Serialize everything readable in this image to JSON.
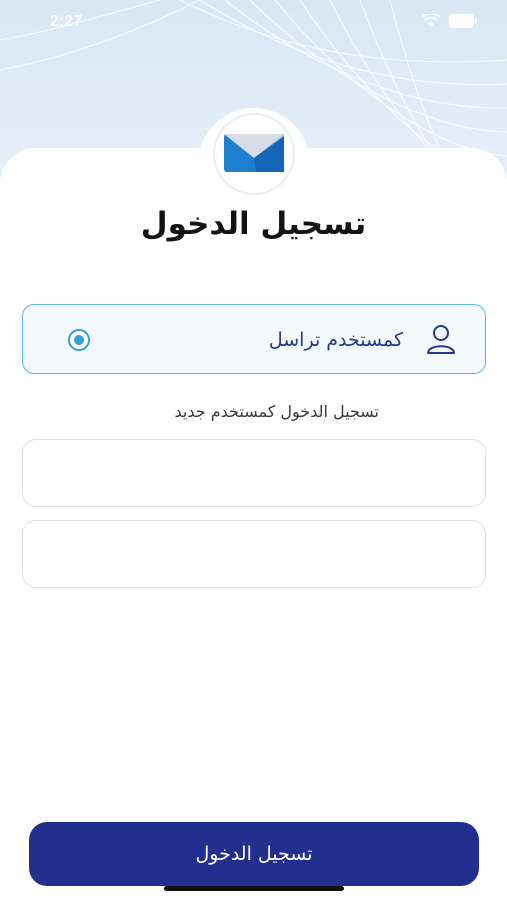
{
  "status_bar": {
    "time": "2:27",
    "icons": [
      "wifi-icon",
      "battery-icon"
    ]
  },
  "header": {
    "logo_icon": "envelope-icon",
    "title": "تسجيل الدخول"
  },
  "account_option": {
    "label": "كمستخدم تراسل",
    "icon": "user-icon",
    "selected": true
  },
  "new_user_link": "تسجيل الدخول كمستخدم جديد",
  "form": {
    "username": {
      "value": "",
      "placeholder": ""
    },
    "password": {
      "value": "",
      "placeholder": ""
    }
  },
  "login_button": "تسجيل الدخول",
  "colors": {
    "primary": "#232f8f",
    "accent": "#2f9fe0",
    "label": "#27378d",
    "envelope": "#1e7fd0"
  }
}
